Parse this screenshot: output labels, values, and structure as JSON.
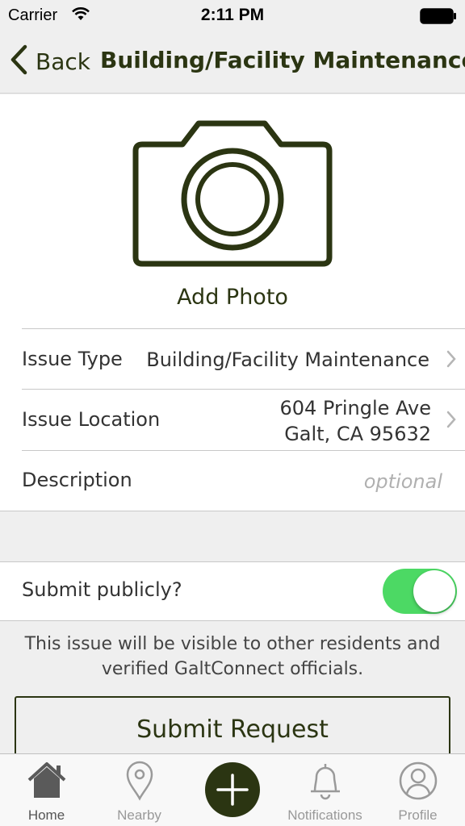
{
  "status_bar": {
    "carrier": "Carrier",
    "time": "2:11 PM"
  },
  "nav": {
    "back_label": "Back",
    "title": "Building/Facility Maintenance"
  },
  "photo": {
    "label": "Add Photo"
  },
  "form": {
    "issue_type": {
      "label": "Issue Type",
      "value": "Building/Facility Maintenance"
    },
    "issue_location": {
      "label": "Issue Location",
      "line1": "604 Pringle Ave",
      "line2": "Galt, CA 95632"
    },
    "description": {
      "label": "Description",
      "placeholder": "optional"
    }
  },
  "public": {
    "label": "Submit publicly?",
    "enabled": true,
    "notice_line1": "This issue will be visible to other residents and",
    "notice_line2": "verified GaltConnect officials."
  },
  "submit_label": "Submit Request",
  "tabs": [
    {
      "label": "Home",
      "icon": "home-icon",
      "active": true
    },
    {
      "label": "Nearby",
      "icon": "location-pin-icon",
      "active": false
    },
    {
      "label": "",
      "icon": "plus-icon",
      "active": false
    },
    {
      "label": "Notifications",
      "icon": "bell-icon",
      "active": false
    },
    {
      "label": "Profile",
      "icon": "profile-icon",
      "active": false
    }
  ],
  "colors": {
    "brand": "#2b3512",
    "toggle_on": "#4cd964",
    "background": "#efefef"
  }
}
